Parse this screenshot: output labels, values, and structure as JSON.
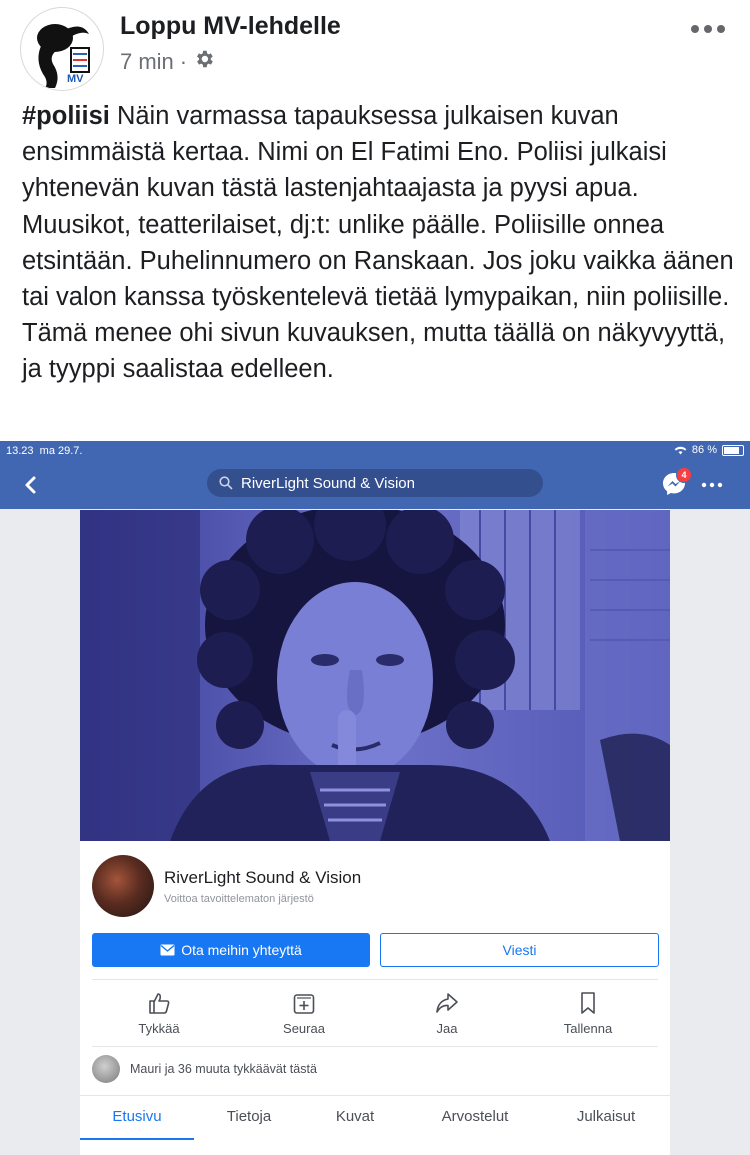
{
  "post": {
    "author": "Loppu MV-lehdelle",
    "time": "7 min",
    "separator": "·",
    "hashtag": "#poliisi",
    "body": " Näin varmassa tapauksessa julkaisen kuvan ensimmäistä kertaa. Nimi on El Fatimi Eno. Poliisi julkaisi yhtenevän kuvan tästä lastenjahtaajasta ja pyysi apua. Muusikot, teatterilaiset, dj:t: unlike päälle. Poliisille onnea etsintään. Puhelinnumero on Ranskaan. Jos joku vaikka äänen tai valon kanssa työskentelevä tietää lymypaikan, niin poliisille. Tämä menee ohi sivun kuvauksen, mutta täällä on näkyvyyttä, ja tyyppi saalistaa edelleen.",
    "avatar_logo_text": "MV"
  },
  "screenshot": {
    "status": {
      "time": "13.23",
      "date": "ma 29.7.",
      "battery": "86 %"
    },
    "search_text": "RiverLight Sound & Vision",
    "messenger_badge": "4",
    "page": {
      "name": "RiverLight Sound & Vision",
      "category": "Voittoa tavoittelematon järjestö",
      "contact_label": "Ota meihin yhteyttä",
      "message_label": "Viesti",
      "actions": [
        "Tykkää",
        "Seuraa",
        "Jaa",
        "Tallenna"
      ],
      "likes_text": "Mauri ja 36 muuta tykkäävät tästä",
      "tabs": [
        "Etusivu",
        "Tietoja",
        "Kuvat",
        "Arvostelut",
        "Julkaisut"
      ]
    }
  },
  "colors": {
    "fb_blue": "#4267b2",
    "button_blue": "#1877f2",
    "cover_tint": "#4a4fb0"
  }
}
